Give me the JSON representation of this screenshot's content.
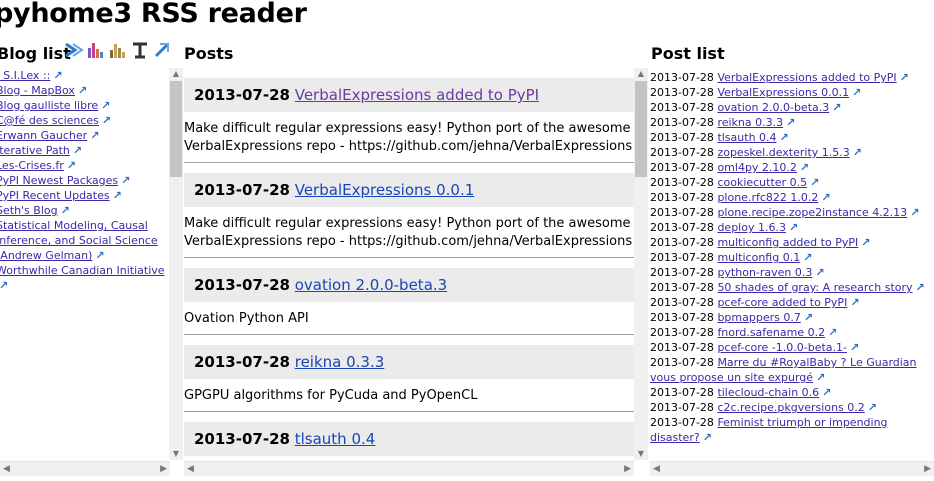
{
  "app": {
    "title": "pyhome3 RSS reader"
  },
  "headers": {
    "blog_list": "Blog list",
    "posts": "Posts",
    "post_list": "Post list"
  },
  "toolbar": [
    {
      "icon": "chevrons-right-icon",
      "color": "#2b7bd1"
    },
    {
      "icon": "bar-chart-colored-icon",
      "color": "#d23a8a"
    },
    {
      "icon": "bar-chart-icon",
      "color": "#c7a44a"
    },
    {
      "icon": "text-cursor-icon",
      "color": "#333333"
    },
    {
      "icon": "arrow-up-right-icon",
      "color": "#2b7bd1"
    }
  ],
  "blogs": [
    ": S.I.Lex ::",
    "Blog - MapBox",
    "Blog gaulliste libre",
    "C@fé des sciences",
    "Erwann Gaucher",
    "Iterative Path",
    "Les-Crises.fr",
    "PyPI Newest Packages",
    "PyPI Recent Updates",
    "Seth's Blog",
    "Statistical Modeling, Causal Inference, and Social Science (Andrew Gelman)",
    "Worthwhile Canadian Initiative"
  ],
  "posts": [
    {
      "date": "2013-07-28",
      "title": "VerbalExpressions added to PyPI",
      "visited": true,
      "body": "Make difficult regular expressions easy! Python port of the awesome VerbalExpressions repo - https://github.com/jehna/VerbalExpressions"
    },
    {
      "date": "2013-07-28",
      "title": "VerbalExpressions 0.0.1",
      "visited": false,
      "body": "Make difficult regular expressions easy! Python port of the awesome VerbalExpressions repo - https://github.com/jehna/VerbalExpressions"
    },
    {
      "date": "2013-07-28",
      "title": "ovation 2.0.0-beta.3",
      "visited": false,
      "body": "Ovation Python API"
    },
    {
      "date": "2013-07-28",
      "title": "reikna 0.3.3",
      "visited": false,
      "body": "GPGPU algorithms for PyCuda and PyOpenCL"
    },
    {
      "date": "2013-07-28",
      "title": "tlsauth 0.4",
      "visited": false,
      "body": ""
    }
  ],
  "post_list": [
    {
      "date": "2013-07-28",
      "title": "VerbalExpressions added to PyPI"
    },
    {
      "date": "2013-07-28",
      "title": "VerbalExpressions 0.0.1"
    },
    {
      "date": "2013-07-28",
      "title": "ovation 2.0.0-beta.3"
    },
    {
      "date": "2013-07-28",
      "title": "reikna 0.3.3"
    },
    {
      "date": "2013-07-28",
      "title": "tlsauth 0.4"
    },
    {
      "date": "2013-07-28",
      "title": "zopeskel.dexterity 1.5.3"
    },
    {
      "date": "2013-07-28",
      "title": "oml4py 2.10.2"
    },
    {
      "date": "2013-07-28",
      "title": "cookiecutter 0.5"
    },
    {
      "date": "2013-07-28",
      "title": "plone.rfc822 1.0.2"
    },
    {
      "date": "2013-07-28",
      "title": "plone.recipe.zope2instance 4.2.13"
    },
    {
      "date": "2013-07-28",
      "title": "deploy 1.6.3"
    },
    {
      "date": "2013-07-28",
      "title": "multiconfig added to PyPI"
    },
    {
      "date": "2013-07-28",
      "title": "multiconfig 0.1"
    },
    {
      "date": "2013-07-28",
      "title": "python-raven 0.3"
    },
    {
      "date": "2013-07-28",
      "title": "50 shades of gray: A research story"
    },
    {
      "date": "2013-07-28",
      "title": "pcef-core added to PyPI"
    },
    {
      "date": "2013-07-28",
      "title": "bpmappers 0.7"
    },
    {
      "date": "2013-07-28",
      "title": "fnord.safename 0.2"
    },
    {
      "date": "2013-07-28",
      "title": "pcef-core -1.0.0-beta.1-"
    },
    {
      "date": "2013-07-28",
      "title": "Marre du #RoyalBaby ? Le Guardian vous propose un site expurgé"
    },
    {
      "date": "2013-07-28",
      "title": "tilecloud-chain 0.6"
    },
    {
      "date": "2013-07-28",
      "title": "c2c.recipe.pkgversions 0.2"
    },
    {
      "date": "2013-07-28",
      "title": "Feminist triumph or impending disaster?"
    }
  ]
}
